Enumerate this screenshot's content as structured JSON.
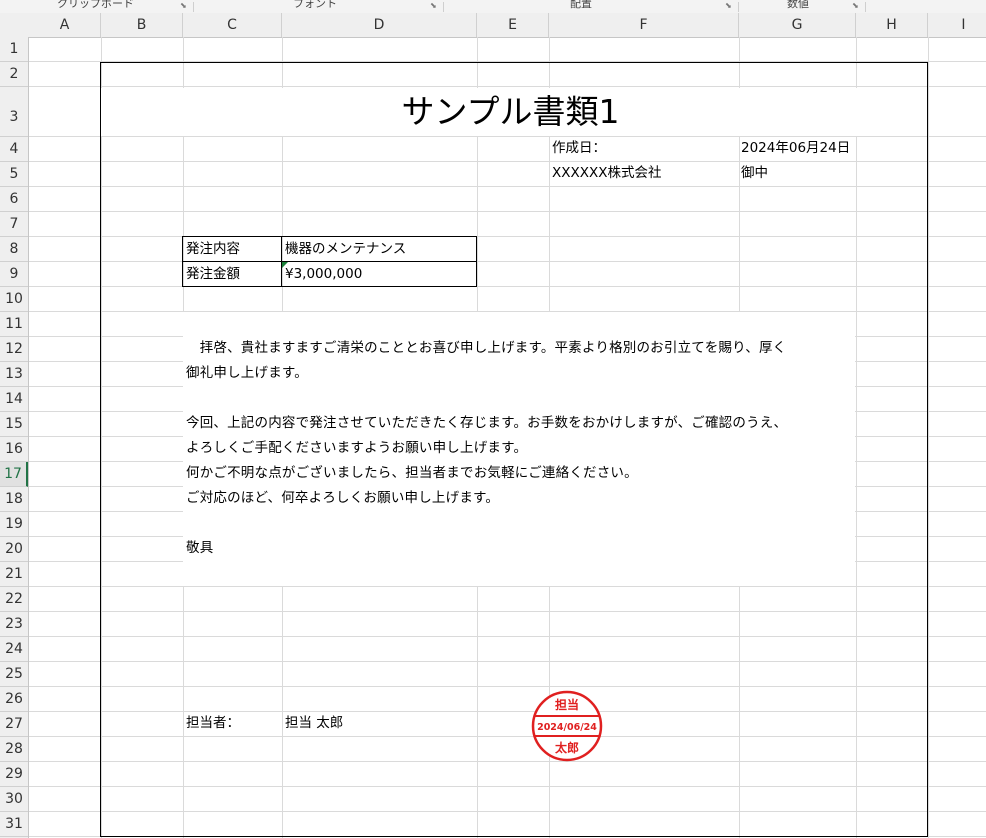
{
  "ribbon": {
    "groups": [
      "クリップボード",
      "フォント",
      "配置",
      "数値"
    ]
  },
  "columns": [
    "A",
    "B",
    "C",
    "D",
    "E",
    "F",
    "G",
    "H",
    "I"
  ],
  "rows": [
    "1",
    "2",
    "3",
    "4",
    "5",
    "6",
    "7",
    "8",
    "9",
    "10",
    "11",
    "12",
    "13",
    "14",
    "15",
    "16",
    "17",
    "18",
    "19",
    "20",
    "21",
    "22",
    "23",
    "24",
    "25",
    "26",
    "27",
    "28",
    "29",
    "30",
    "31"
  ],
  "selected_row": "17",
  "document": {
    "title": "サンプル書類1",
    "created_label": "作成日：",
    "created_date": "2024年06月24日",
    "recipient": "XXXXXX株式会社",
    "honorific": "御中",
    "order_table": {
      "rows": [
        {
          "label": "発注内容",
          "value": "機器のメンテナンス"
        },
        {
          "label": "発注金額",
          "value": "¥3,000,000"
        }
      ]
    },
    "body_lines": [
      "　拝啓、貴社ますますご清栄のこととお喜び申し上げます。平素より格別のお引立てを賜り、厚く",
      "御礼申し上げます。",
      "",
      "今回、上記の内容で発注させていただきたく存じます。お手数をおかけしますが、ご確認のうえ、",
      "よろしくご手配くださいますようお願い申し上げます。",
      "何かご不明な点がございましたら、担当者までお気軽にご連絡ください。",
      "ご対応のほど、何卒よろしくお願い申し上げます。",
      "",
      "敬具"
    ],
    "person_label": "担当者：",
    "person_name": "担当 太郎",
    "stamp": {
      "top": "担当",
      "date": "2024/06/24",
      "bottom": "太郎",
      "color": "#e02020"
    }
  }
}
